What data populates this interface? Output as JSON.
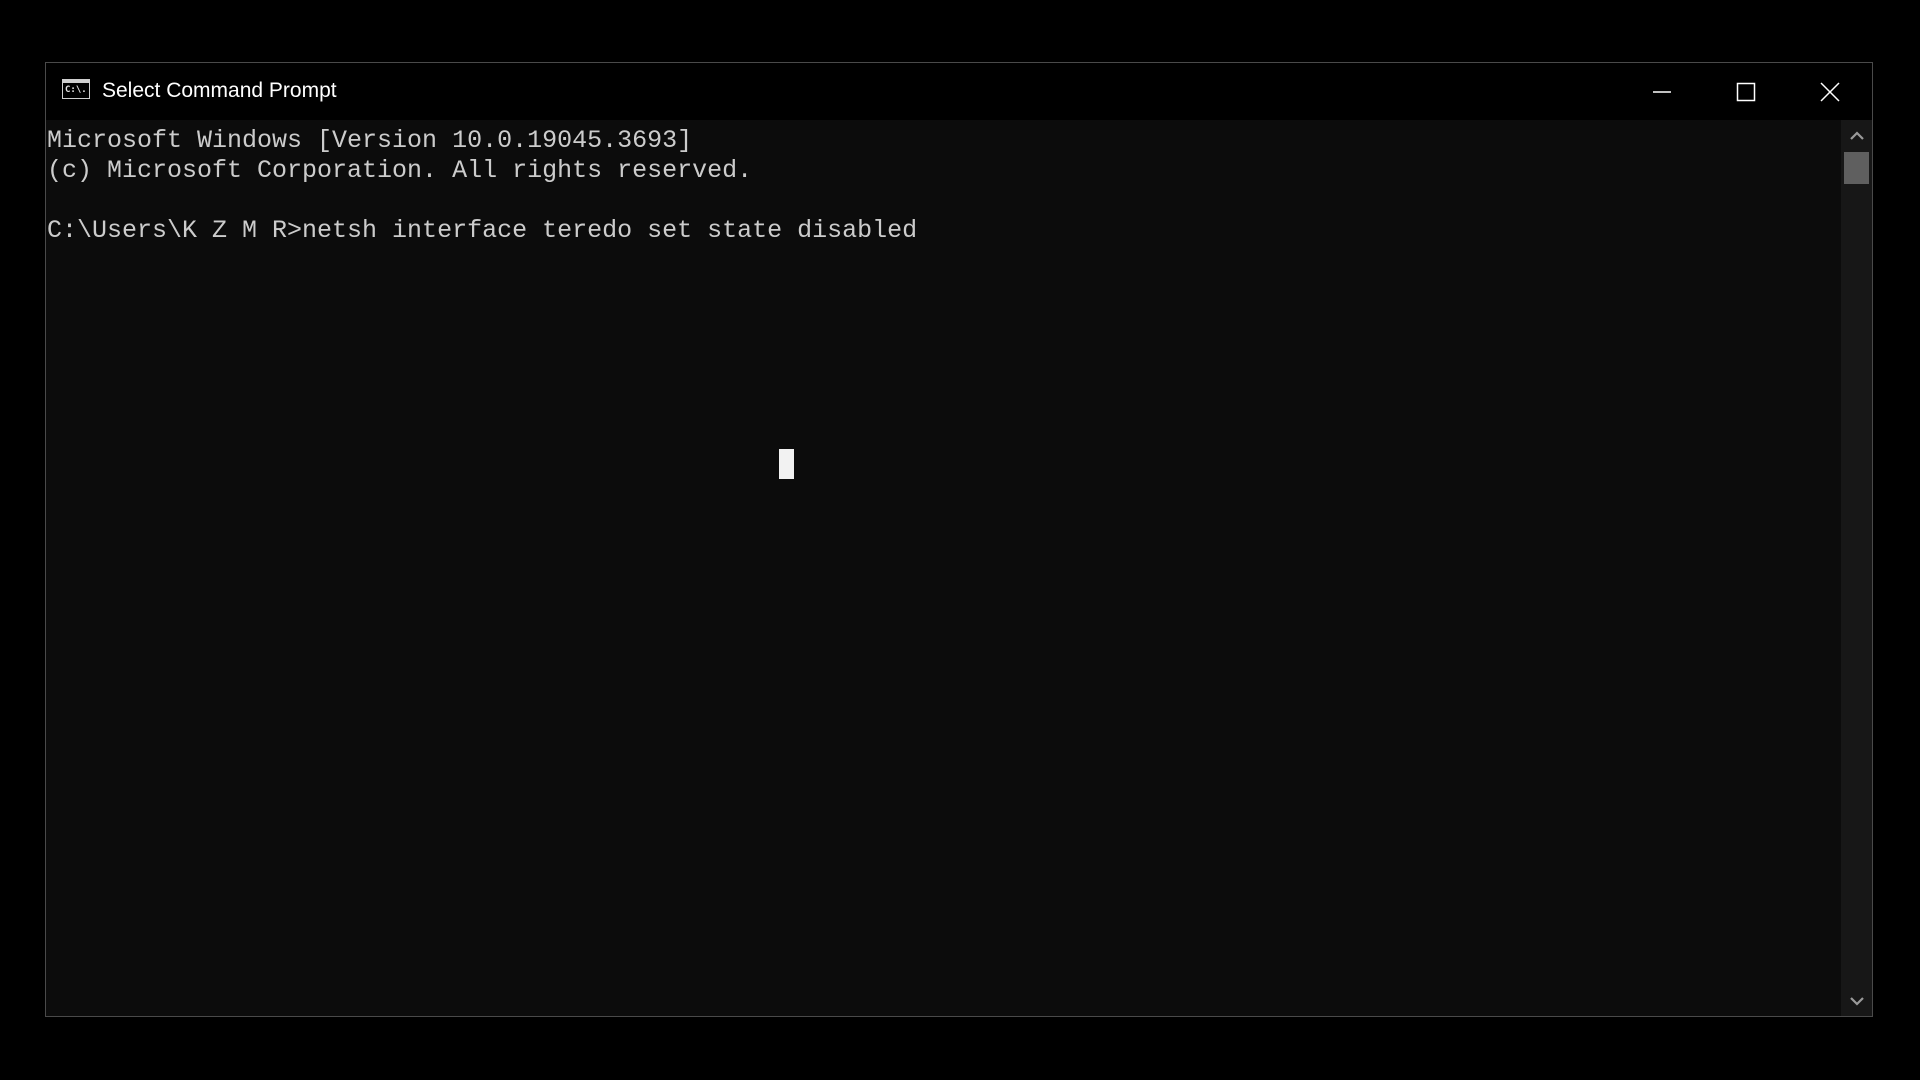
{
  "window": {
    "title": "Select Command Prompt",
    "app_icon": "cmd-icon",
    "app_icon_text": "C:\\.",
    "controls": {
      "minimize": "minimize-icon",
      "maximize": "maximize-icon",
      "close": "close-icon"
    }
  },
  "console": {
    "lines": [
      "Microsoft Windows [Version 10.0.19045.3693]",
      "(c) Microsoft Corporation. All rights reserved.",
      "",
      "C:\\Users\\K Z M R>netsh interface teredo set state disabled"
    ],
    "text_color": "#cccccc",
    "background": "#0c0c0c"
  },
  "scrollbar": {
    "position": 0
  }
}
